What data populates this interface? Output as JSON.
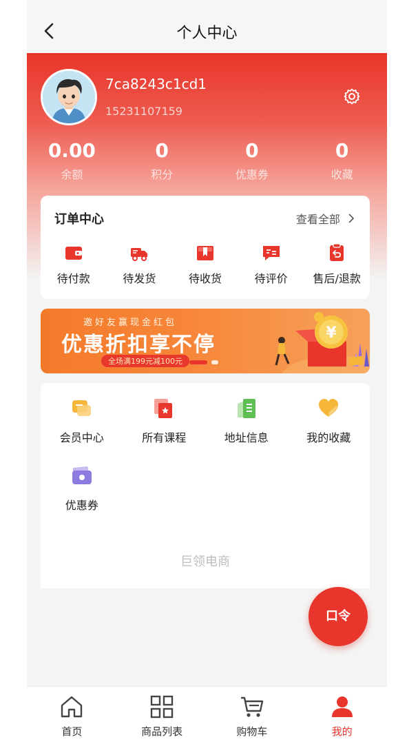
{
  "header": {
    "title": "个人中心"
  },
  "profile": {
    "username": "7ca8243c1cd1",
    "phone": "15231107159"
  },
  "stats": [
    {
      "value": "0.00",
      "label": "余额"
    },
    {
      "value": "0",
      "label": "积分"
    },
    {
      "value": "0",
      "label": "优惠券"
    },
    {
      "value": "0",
      "label": "收藏"
    }
  ],
  "orders": {
    "title": "订单中心",
    "view_all": "查看全部",
    "items": [
      {
        "label": "待付款",
        "icon": "wallet-icon"
      },
      {
        "label": "待发货",
        "icon": "truck-icon"
      },
      {
        "label": "待收货",
        "icon": "package-icon"
      },
      {
        "label": "待评价",
        "icon": "review-icon"
      },
      {
        "label": "售后/退款",
        "icon": "refund-icon"
      }
    ]
  },
  "banner": {
    "subtitle": "邀好友赢现金红包",
    "title": "优惠折扣享不停",
    "pill": "全场满199元减100元"
  },
  "services": [
    {
      "label": "会员中心",
      "icon": "member-icon"
    },
    {
      "label": "所有课程",
      "icon": "courses-icon"
    },
    {
      "label": "地址信息",
      "icon": "address-icon"
    },
    {
      "label": "我的收藏",
      "icon": "favorite-icon"
    },
    {
      "label": "优惠券",
      "icon": "coupon-icon"
    }
  ],
  "brand": "巨领电商",
  "fab": {
    "label": "口令"
  },
  "tabbar": [
    {
      "label": "首页",
      "icon": "home-icon"
    },
    {
      "label": "商品列表",
      "icon": "grid-icon"
    },
    {
      "label": "购物车",
      "icon": "cart-icon"
    },
    {
      "label": "我的",
      "icon": "user-icon",
      "active": true
    }
  ],
  "colors": {
    "accent": "#e8362c",
    "banner": "#f47a2a",
    "gold": "#f5b63a",
    "green": "#7bc96f",
    "purple": "#8e7be0"
  }
}
